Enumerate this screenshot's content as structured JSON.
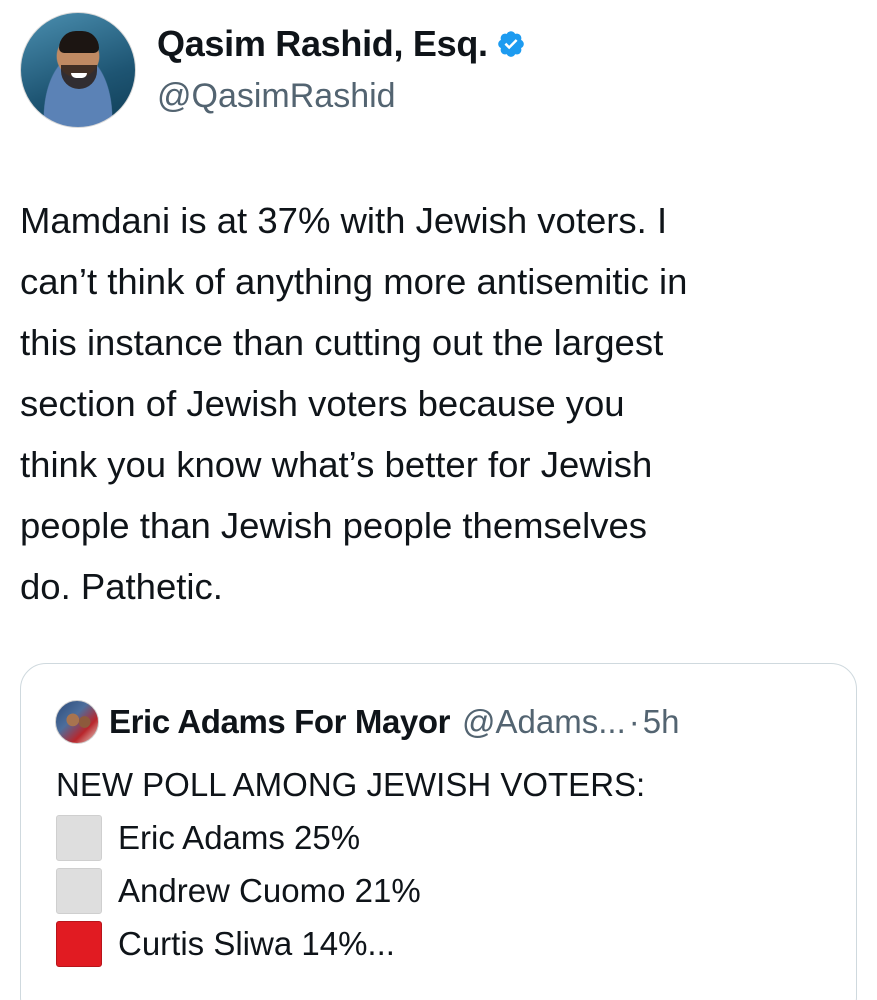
{
  "author": {
    "display_name": "Qasim Rashid, Esq.",
    "handle": "@QasimRashid",
    "verified_icon": "verified-badge-icon",
    "verified_color": "#1d9bf0"
  },
  "tweet": {
    "text": "Mamdani is at 37% with Jewish voters.  I\ncan’t think of anything more antisemitic in\nthis instance than cutting out the largest\nsection of Jewish voters because you\nthink you know what’s better for Jewish\npeople than Jewish people themselves\ndo. Pathetic."
  },
  "quoted_tweet": {
    "display_name": "Eric Adams For Mayor",
    "handle": "@Adams...",
    "separator": "·",
    "time": "5h",
    "headline": "NEW POLL AMONG JEWISH VOTERS:",
    "items": [
      {
        "label": "Eric Adams 25%",
        "box_color": "#dedede"
      },
      {
        "label": "Andrew Cuomo 21%",
        "box_color": "#dedede"
      },
      {
        "label": "Curtis Sliwa 14%...",
        "box_color": "#e11b22"
      }
    ]
  }
}
